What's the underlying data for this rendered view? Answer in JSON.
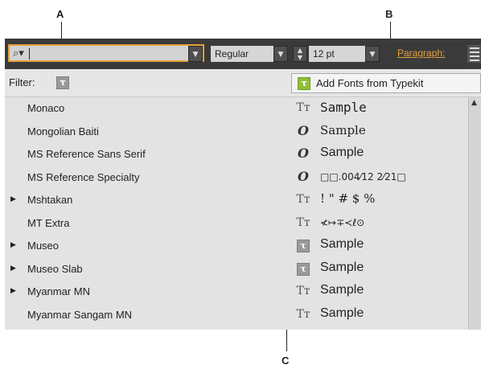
{
  "callouts": {
    "a": "A",
    "b": "B",
    "c": "C"
  },
  "toolbar": {
    "style_value": "Regular",
    "size_value": "12 pt",
    "paragraph_link": "Paragraph:"
  },
  "filter": {
    "label": "Filter:",
    "add_fonts_label": "Add Fonts from Typekit"
  },
  "fonts": [
    {
      "name": "Monaco",
      "expandable": false,
      "icon": "truetype-icon",
      "sample": "Sample"
    },
    {
      "name": "Mongolian Baiti",
      "expandable": false,
      "icon": "opentype-icon",
      "sample": "Sample"
    },
    {
      "name": "MS Reference Sans Serif",
      "expandable": false,
      "icon": "opentype-icon",
      "sample": "Sample"
    },
    {
      "name": "MS Reference Specialty",
      "expandable": false,
      "icon": "opentype-icon",
      "sample": "□□.004⁄12 2⁄21□"
    },
    {
      "name": "Mshtakan",
      "expandable": true,
      "icon": "truetype-icon",
      "sample": "! \" # $ %"
    },
    {
      "name": "MT Extra",
      "expandable": false,
      "icon": "truetype-icon",
      "sample": "≮↦∓≺ℓ⊙"
    },
    {
      "name": "Museo",
      "expandable": true,
      "icon": "typekit-icon",
      "sample": "Sample"
    },
    {
      "name": "Museo Slab",
      "expandable": true,
      "icon": "typekit-icon",
      "sample": "Sample"
    },
    {
      "name": "Myanmar MN",
      "expandable": true,
      "icon": "truetype-icon",
      "sample": "Sample"
    },
    {
      "name": "Myanmar Sangam MN",
      "expandable": false,
      "icon": "truetype-icon",
      "sample": "Sample"
    }
  ],
  "icons": {
    "truetype": "Tт",
    "opentype": "O",
    "typekit": "τ"
  },
  "colors": {
    "accent": "#e8a23a",
    "typekit_green": "#8fbf3a"
  }
}
